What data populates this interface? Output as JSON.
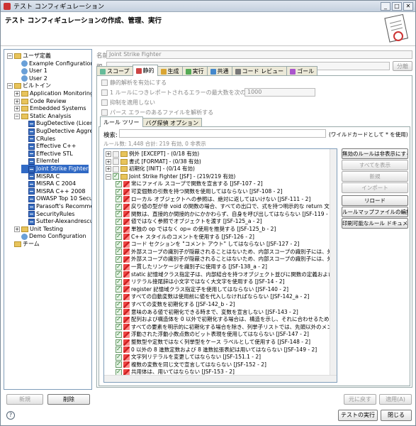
{
  "window": {
    "title": "テスト コンフィギュレーション",
    "min": "_",
    "max": "□",
    "close": "✕"
  },
  "header": {
    "title": "テスト コンフィギュレーションの作成、管理、実行"
  },
  "tree": [
    {
      "label": "ユーザ定義",
      "level": 0,
      "expander": "−",
      "kind": "folder"
    },
    {
      "label": "Example Configuration",
      "level": 1,
      "kind": "user"
    },
    {
      "label": "User 1",
      "level": 1,
      "kind": "user"
    },
    {
      "label": "User 2",
      "level": 1,
      "kind": "user"
    },
    {
      "label": "ビルトイン",
      "level": 0,
      "expander": "−",
      "kind": "folder"
    },
    {
      "label": "Application Monitoring",
      "level": 1,
      "expander": "+",
      "kind": "folder"
    },
    {
      "label": "Code Review",
      "level": 1,
      "expander": "+",
      "kind": "folder"
    },
    {
      "label": "Embedded Systems",
      "level": 1,
      "expander": "+",
      "kind": "folder"
    },
    {
      "label": "Static Analysis",
      "level": 1,
      "expander": "−",
      "kind": "folder"
    },
    {
      "label": "BugDetective (License",
      "level": 2,
      "kind": "rule"
    },
    {
      "label": "BugDetective Aggress",
      "level": 2,
      "kind": "rule"
    },
    {
      "label": "CRules",
      "level": 2,
      "kind": "rule"
    },
    {
      "label": "Effective C++",
      "level": 2,
      "kind": "rule"
    },
    {
      "label": "Effective STL",
      "level": 2,
      "kind": "rule"
    },
    {
      "label": "Ellemtel",
      "level": 2,
      "kind": "rule"
    },
    {
      "label": "Joint Strike Fighter",
      "level": 2,
      "kind": "rule",
      "selected": true
    },
    {
      "label": "MISRA C",
      "level": 2,
      "kind": "rule"
    },
    {
      "label": "MISRA C 2004",
      "level": 2,
      "kind": "rule"
    },
    {
      "label": "MISRA C++ 2008",
      "level": 2,
      "kind": "rule"
    },
    {
      "label": "OWASP Top 10 Secur",
      "level": 2,
      "kind": "rule"
    },
    {
      "label": "Parasoft's Recommen",
      "level": 2,
      "kind": "rule"
    },
    {
      "label": "SecurityRules",
      "level": 2,
      "kind": "rule"
    },
    {
      "label": "Sutter-Alexandrescu",
      "level": 2,
      "kind": "rule"
    },
    {
      "label": "Unit Testing",
      "level": 1,
      "expander": "+",
      "kind": "folder"
    },
    {
      "label": "Demo Configuration",
      "level": 1,
      "kind": "user"
    },
    {
      "label": "チーム",
      "level": 0,
      "kind": "folder"
    }
  ],
  "form": {
    "name_label": "名前",
    "name_value": "Joint Strike Fighter",
    "parent_label": "親",
    "split_label": "分離"
  },
  "tabs": [
    "スコープ",
    "静的",
    "生成",
    "実行",
    "共通",
    "コード レビュー",
    "ゴール"
  ],
  "options": {
    "enable": "静的解析を有効にする",
    "limit": "1 ルールにつきレポートされるエラーの最大数を次の数に制限する",
    "limit_value": "1000",
    "suppress": "抑制を適用しない",
    "parse": "パース エラーのあるファイルを解析する"
  },
  "subtabs": [
    "ルール ツリー",
    "バグ探偵 オプション"
  ],
  "search": {
    "label": "検索:",
    "value": "",
    "hint": "(ワイルドカードとして * を使用)"
  },
  "summary": "ルール数: 1,448 合計: 219 有効, 0 非表示",
  "rules": [
    {
      "text": "例外 [EXCEPT] - (0/18 有効)",
      "level": 0,
      "group": true
    },
    {
      "text": "書式 [FORMAT] - (0/38 有効)",
      "level": 0,
      "group": true
    },
    {
      "text": "初期化 [INIT] - (0/14 有効)",
      "level": 0,
      "group": true
    },
    {
      "text": "Joint Strike Fighter [JSF] - (219/219 有効)",
      "level": 0,
      "group": true,
      "open": true
    },
    {
      "text": "常にファイル スコープで関数を宣言する [JSF-107 - 2]",
      "level": 1
    },
    {
      "text": "可変個数の引数を持つ関数を使用してはならない [JSF-108 - 2]",
      "level": 1
    },
    {
      "text": "ローカル オブジェクトへの参照は、絶対に返してはいけない [JSF-111 - 2]",
      "level": 1
    },
    {
      "text": "戻り値の型が非 void の関数の場合、すべての出口で、式を持つ明示的な return 文を記述",
      "level": 1
    },
    {
      "text": "関数は、直接的か間接的かにかかわらず、自身を呼び出してはならない [JSF-119 - 2]",
      "level": 1
    },
    {
      "text": "値ではなく参照でオブジェクトを渡す [JSF-125_a - 2]",
      "level": 1
    },
    {
      "text": "単独の op ではなく op= の使用を推奨する [JSF-125_b - 2]",
      "level": 1
    },
    {
      "text": "C++ スタイルのコメントを使用する [JSF-126 - 2]",
      "level": 1
    },
    {
      "text": "コード セクションを \"コメント アウト\" してはならない [JSF-127 - 2]",
      "level": 1
    },
    {
      "text": "外部スコープの識別子が隠蔽されることはないため、内部スコープの識別子には、外部スコープ",
      "level": 1
    },
    {
      "text": "外部スコープの識別子が隠蔽されることはないため、内部スコープの識別子には、外部スコープ",
      "level": 1
    },
    {
      "text": "一貫したリンケージを識別子に使用する [JSF-138_a - 2]",
      "level": 1
    },
    {
      "text": "static 記憶域クラス指定子は、内部結合を持つオブジェクト並びに関数の定義および宣言に",
      "level": 1
    },
    {
      "text": "リテラル接尾辞は小文字ではなく大文字を使用する [JSF-14 - 2]",
      "level": 1
    },
    {
      "text": "register 記憶域クラス指定子を使用してはならない [JSF-140 - 2]",
      "level": 1
    },
    {
      "text": "すべての自動変数は使用前に値を代入しなければならない [JSF-142_a - 2]",
      "level": 1
    },
    {
      "text": "すべての変数を初期化する [JSF-142_b - 2]",
      "level": 1
    },
    {
      "text": "意味のある値で初期化できる時まで、変数を宣言しない [JSF-143 - 2]",
      "level": 1
    },
    {
      "text": "配列および構造体を 0 以外で初期化する場合は、構造を示し、それに合わせるために波括弧",
      "level": 1
    },
    {
      "text": "すべての要素を明示的に初期化する場合を除き、列挙子リストでは、先頭以外のメンバを明示",
      "level": 1
    },
    {
      "text": "浮動された浮動小数点数のビット表現を使用してはならない [JSF-147 - 2]",
      "level": 1
    },
    {
      "text": "整数型や定数ではなく列挙型をケース ラベルとして使用する [JSF-148 - 2]",
      "level": 1
    },
    {
      "text": "0 以外の 8 進数定数および 8 進数拡張表記は用いてはならない [JSF-149 - 2]",
      "level": 1
    },
    {
      "text": "文字列リテラルを変更してはならない [JSF-151.1 - 2]",
      "level": 1
    },
    {
      "text": "複数の変数を同じ文で宣言してはならない [JSF-152 - 2]",
      "level": 1
    },
    {
      "text": "共用体は、用いてはならない [JSF-153 - 2]",
      "level": 1
    },
    {
      "text": "ビットフィールドは、unsigned int 型または signed int 型だけで定義しなければならない [JSF-",
      "level": 1
    }
  ],
  "side_buttons": [
    "無効のルールは非表示にする",
    "すべてを表示",
    "新規",
    "インポート",
    "リロード",
    "ルールマップファイルの編集",
    "印刷可能なルール ドキュメント"
  ],
  "bottom": {
    "new": "新規",
    "delete": "削除",
    "restore": "元に戻す",
    "apply": "適用(A)",
    "run": "テストの実行",
    "close": "閉じる",
    "help": "?"
  }
}
